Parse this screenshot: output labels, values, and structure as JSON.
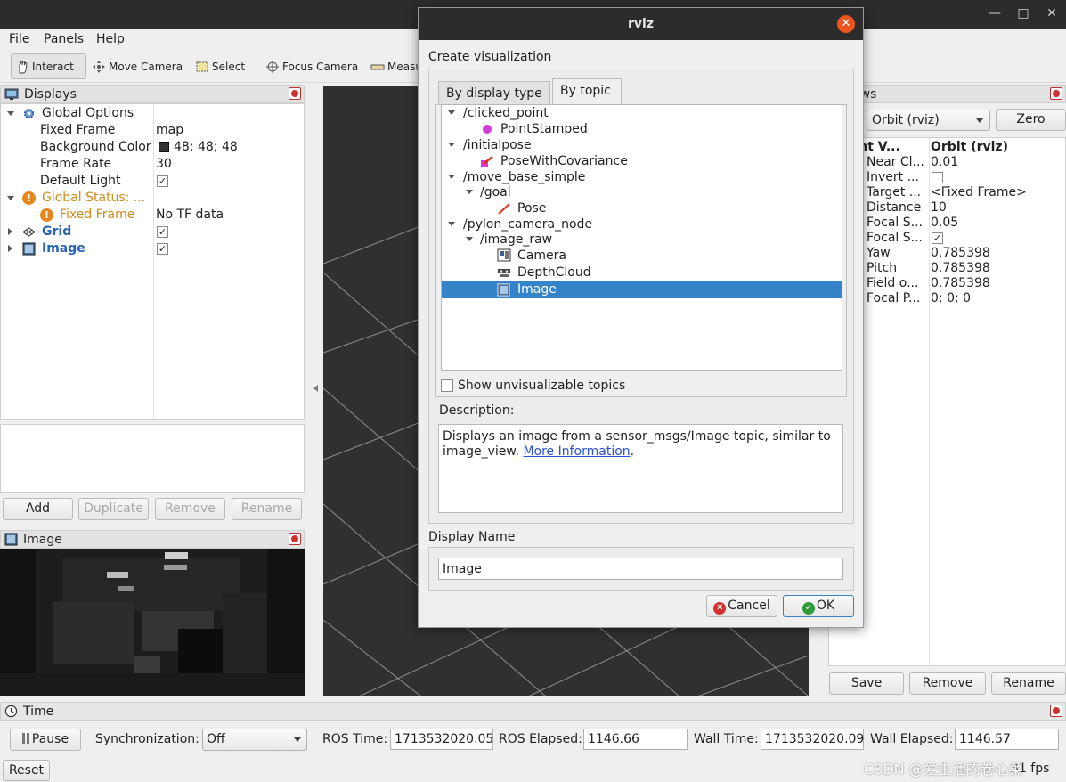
{
  "app": {
    "window_title": "rviz",
    "window_controls": [
      "minimize",
      "maximize",
      "close"
    ]
  },
  "menu": {
    "items": [
      "File",
      "Panels",
      "Help"
    ]
  },
  "toolbar": {
    "tools": [
      {
        "label": "Interact",
        "icon": "hand-icon",
        "active": true
      },
      {
        "label": "Move Camera",
        "icon": "move-camera-icon",
        "active": false
      },
      {
        "label": "Select",
        "icon": "select-icon",
        "active": false
      },
      {
        "label": "Focus Camera",
        "icon": "focus-camera-icon",
        "active": false
      },
      {
        "label": "Measu",
        "icon": "measure-icon",
        "active": false
      }
    ]
  },
  "displays": {
    "title": "Displays",
    "rows": [
      {
        "name": "Global Options",
        "value": ""
      },
      {
        "name": "Fixed Frame",
        "value": "map"
      },
      {
        "name": "Background Color",
        "value": "48; 48; 48"
      },
      {
        "name": "Frame Rate",
        "value": "30"
      },
      {
        "name": "Default Light",
        "value": ""
      },
      {
        "name": "Global Status: ...",
        "value": ""
      },
      {
        "name": "Fixed Frame",
        "value": "No TF data"
      },
      {
        "name": "Grid",
        "value": ""
      },
      {
        "name": "Image",
        "value": ""
      }
    ],
    "buttons": {
      "add": "Add",
      "duplicate": "Duplicate",
      "remove": "Remove",
      "rename": "Rename"
    }
  },
  "image_panel": {
    "title": "Image"
  },
  "views": {
    "title_visible": "ews",
    "type_select": "Orbit (rviz)",
    "zero": "Zero",
    "header": {
      "name": "urrent V...",
      "value": "Orbit (rviz)"
    },
    "rows": [
      {
        "name": "Near Cl...",
        "value": "0.01"
      },
      {
        "name": "Invert ...",
        "value": ""
      },
      {
        "name": "Target ...",
        "value": "<Fixed Frame>"
      },
      {
        "name": "Distance",
        "value": "10"
      },
      {
        "name": "Focal S...",
        "value": "0.05"
      },
      {
        "name": "Focal S...",
        "value": ""
      },
      {
        "name": "Yaw",
        "value": "0.785398"
      },
      {
        "name": "Pitch",
        "value": "0.785398"
      },
      {
        "name": "Field o...",
        "value": "0.785398"
      },
      {
        "name": "Focal P...",
        "value": "0; 0; 0"
      }
    ],
    "buttons": {
      "save": "Save",
      "remove": "Remove",
      "rename": "Rename"
    }
  },
  "time": {
    "title": "Time",
    "pause": "Pause",
    "sync_label": "Synchronization:",
    "sync_value": "Off",
    "ros_time_label": "ROS Time:",
    "ros_time": "1713532020.05",
    "ros_elapsed_label": "ROS Elapsed:",
    "ros_elapsed": "1146.66",
    "wall_time_label": "Wall Time:",
    "wall_time": "1713532020.09",
    "wall_elapsed_label": "Wall Elapsed:",
    "wall_elapsed": "1146.57",
    "reset": "Reset",
    "fps": "31 fps",
    "watermark": "CSDN @爱生活的卷心菜"
  },
  "dialog": {
    "title": "rviz",
    "heading": "Create visualization",
    "tabs": [
      "By display type",
      "By topic"
    ],
    "active_tab": "By topic",
    "tree": [
      {
        "label": "/clicked_point",
        "depth": 0,
        "kind": "topic"
      },
      {
        "label": "PointStamped",
        "depth": 1,
        "kind": "display",
        "icon": "point-stamped-icon"
      },
      {
        "label": "/initialpose",
        "depth": 0,
        "kind": "topic"
      },
      {
        "label": "PoseWithCovariance",
        "depth": 1,
        "kind": "display",
        "icon": "pose-covariance-icon"
      },
      {
        "label": "/move_base_simple",
        "depth": 0,
        "kind": "topic"
      },
      {
        "label": "/goal",
        "depth": 1,
        "kind": "topic"
      },
      {
        "label": "Pose",
        "depth": 2,
        "kind": "display",
        "icon": "pose-arrow-icon"
      },
      {
        "label": "/pylon_camera_node",
        "depth": 0,
        "kind": "topic"
      },
      {
        "label": "/image_raw",
        "depth": 1,
        "kind": "topic"
      },
      {
        "label": "Camera",
        "depth": 2,
        "kind": "display",
        "icon": "camera-icon"
      },
      {
        "label": "DepthCloud",
        "depth": 2,
        "kind": "display",
        "icon": "depth-cloud-icon"
      },
      {
        "label": "Image",
        "depth": 2,
        "kind": "display",
        "icon": "image-icon",
        "selected": true
      }
    ],
    "show_unvisualizable": "Show unvisualizable topics",
    "description_label": "Description:",
    "description_text": "Displays an image from a sensor_msgs/Image topic, similar to image_view.",
    "description_link": "More Information",
    "display_name_label": "Display Name",
    "display_name_value": "Image",
    "cancel": "Cancel",
    "ok": "OK"
  },
  "colors": {
    "selection": "#3584c9",
    "title_bar": "#2c2c2c",
    "view_background": "#303030",
    "warning": "#e7861f",
    "link": "#2a4ed6"
  }
}
